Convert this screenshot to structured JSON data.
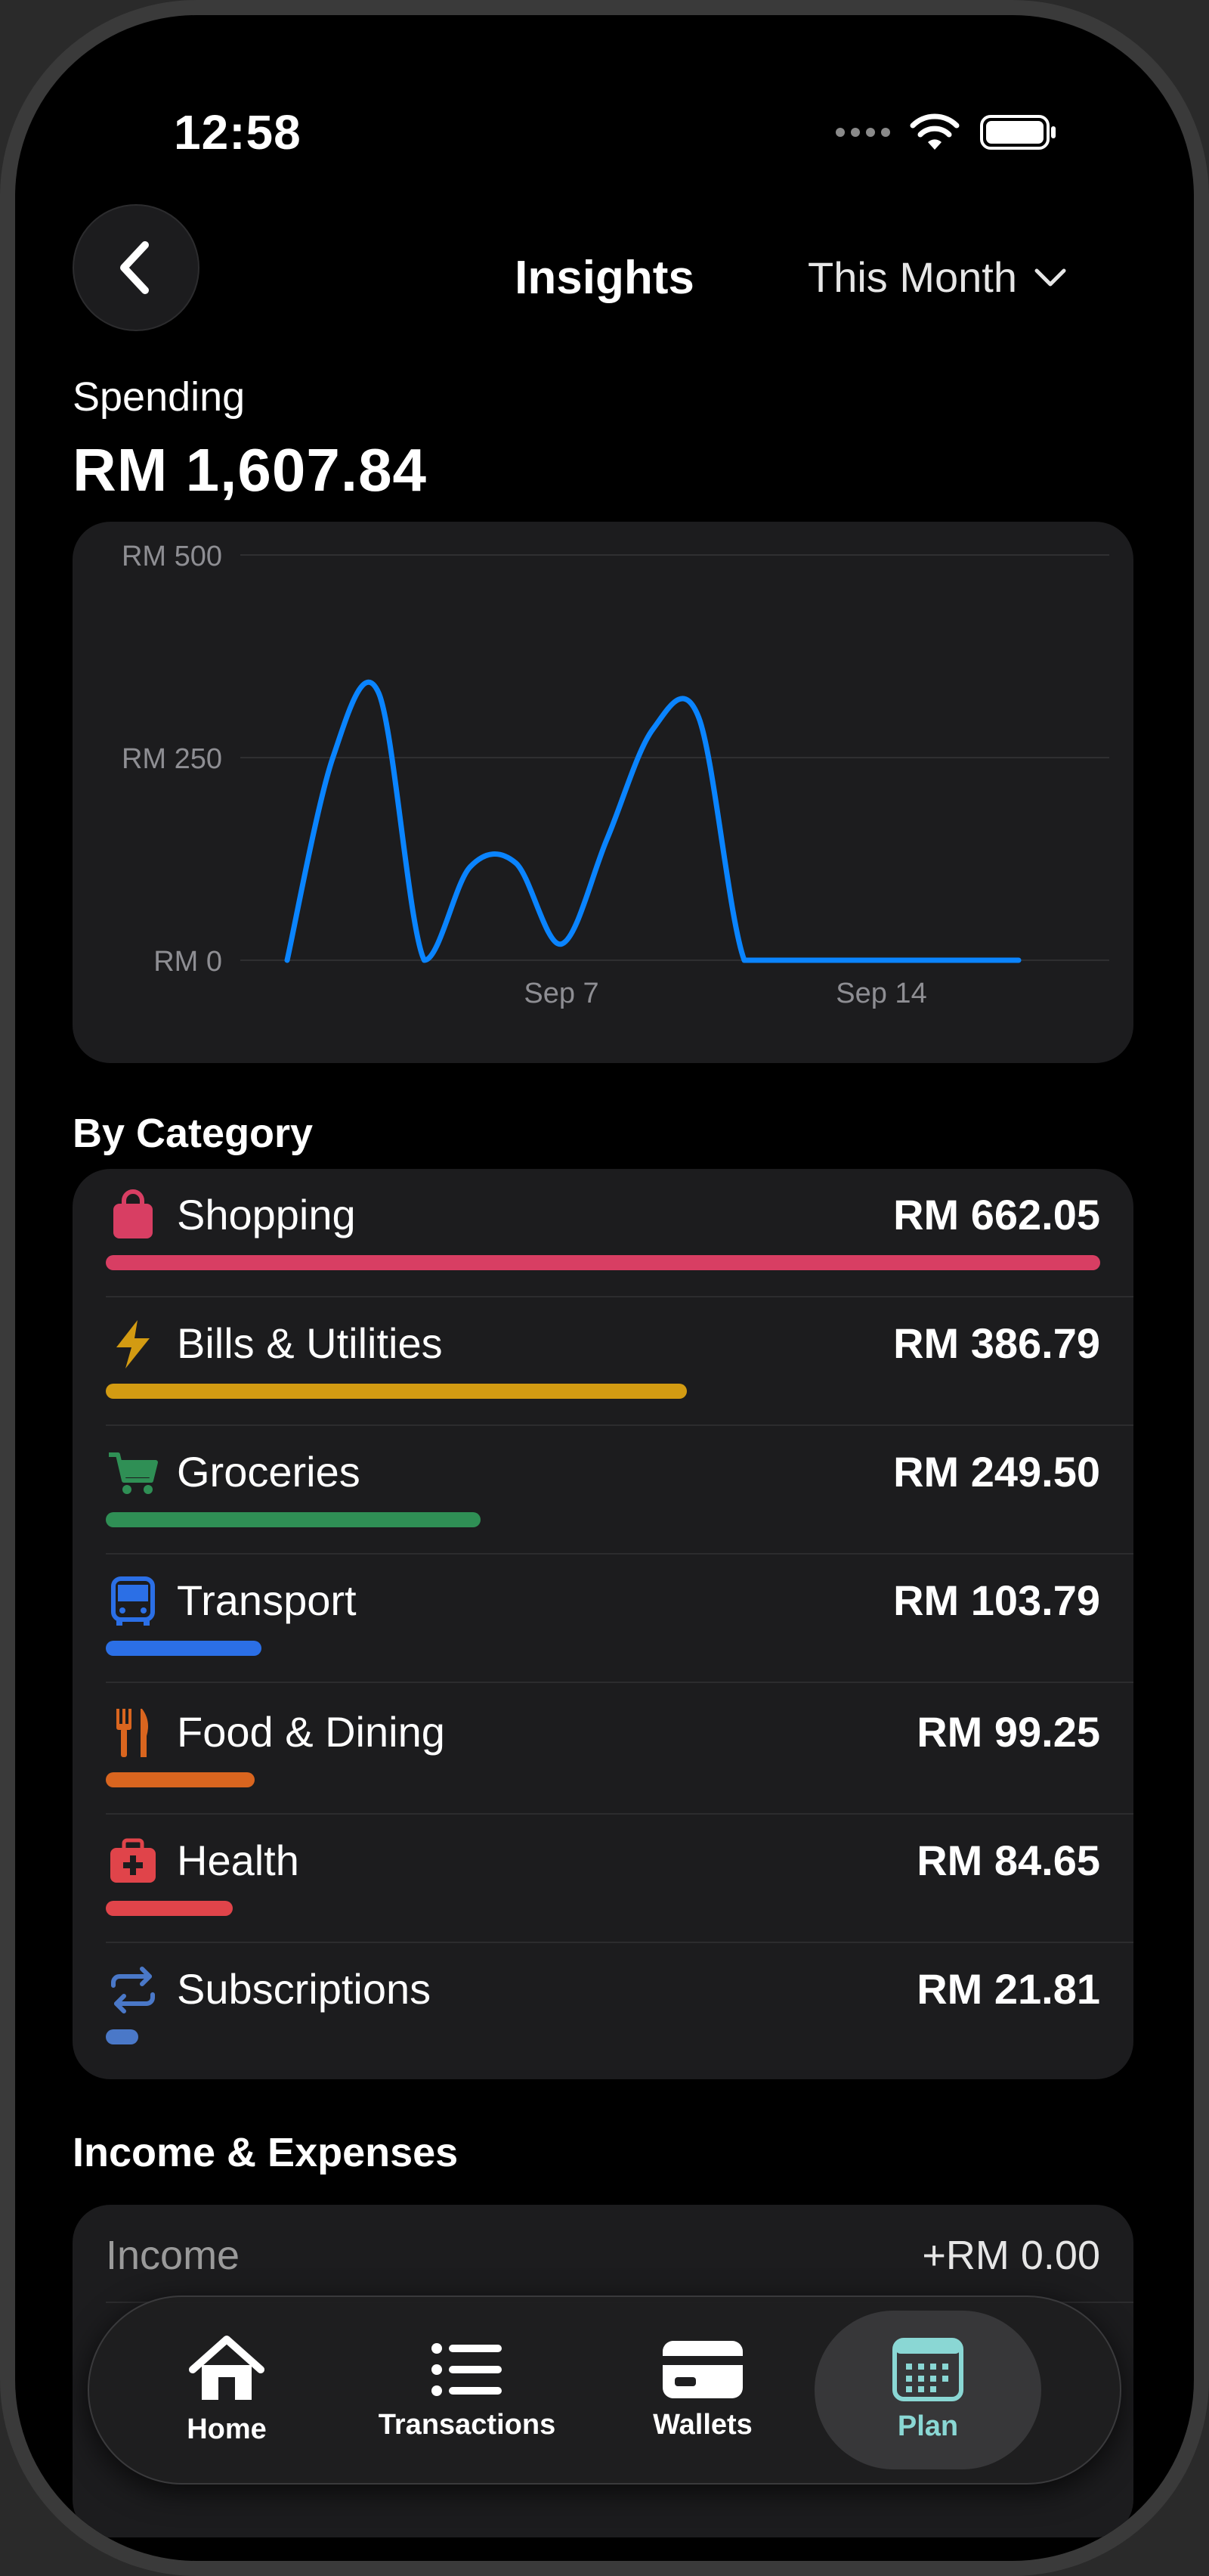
{
  "status_bar": {
    "time": "12:58"
  },
  "header": {
    "title": "Insights",
    "period": "This Month"
  },
  "spending": {
    "label": "Spending",
    "amount": "RM 1,607.84"
  },
  "chart_data": {
    "type": "line",
    "title": "",
    "xlabel": "",
    "ylabel": "",
    "ylim": [
      0,
      500
    ],
    "yticks": [
      "RM 0",
      "RM 250",
      "RM 500"
    ],
    "xticks": [
      "Sep 7",
      "Sep 14"
    ],
    "grid": true,
    "series": [
      {
        "color": "#0a84ff",
        "x": [
          "Sep 1",
          "Sep 2",
          "Sep 3",
          "Sep 4",
          "Sep 5",
          "Sep 6",
          "Sep 7",
          "Sep 8",
          "Sep 9",
          "Sep 10",
          "Sep 11",
          "Sep 12",
          "Sep 13",
          "Sep 14",
          "Sep 15",
          "Sep 16",
          "Sep 17"
        ],
        "values": [
          0,
          250,
          330,
          0,
          115,
          120,
          20,
          150,
          285,
          300,
          0,
          0,
          0,
          0,
          0,
          0,
          0
        ]
      }
    ]
  },
  "categories": {
    "title": "By Category",
    "items": [
      {
        "name": "Shopping",
        "amount": "RM 662.05",
        "value": 662.05,
        "color": "#d83e63",
        "icon": "shopping-bag-icon"
      },
      {
        "name": "Bills & Utilities",
        "amount": "RM 386.79",
        "value": 386.79,
        "color": "#d39b12",
        "icon": "lightning-icon"
      },
      {
        "name": "Groceries",
        "amount": "RM 249.50",
        "value": 249.5,
        "color": "#2f8f55",
        "icon": "cart-icon"
      },
      {
        "name": "Transport",
        "amount": "RM 103.79",
        "value": 103.79,
        "color": "#2b6fe6",
        "icon": "bus-icon"
      },
      {
        "name": "Food & Dining",
        "amount": "RM 99.25",
        "value": 99.25,
        "color": "#d9651f",
        "icon": "fork-knife-icon"
      },
      {
        "name": "Health",
        "amount": "RM 84.65",
        "value": 84.65,
        "color": "#e0444a",
        "icon": "medical-kit-icon"
      },
      {
        "name": "Subscriptions",
        "amount": "RM 21.81",
        "value": 21.81,
        "color": "#4a78c8",
        "icon": "repeat-icon"
      }
    ]
  },
  "income_expenses": {
    "title": "Income & Expenses",
    "income_label": "Income",
    "income_value": "+RM 0.00"
  },
  "tab_bar": {
    "tabs": [
      {
        "label": "Home",
        "icon": "home-icon"
      },
      {
        "label": "Transactions",
        "icon": "list-icon"
      },
      {
        "label": "Wallets",
        "icon": "wallet-icon"
      },
      {
        "label": "Plan",
        "icon": "calendar-icon",
        "active": true
      }
    ]
  }
}
